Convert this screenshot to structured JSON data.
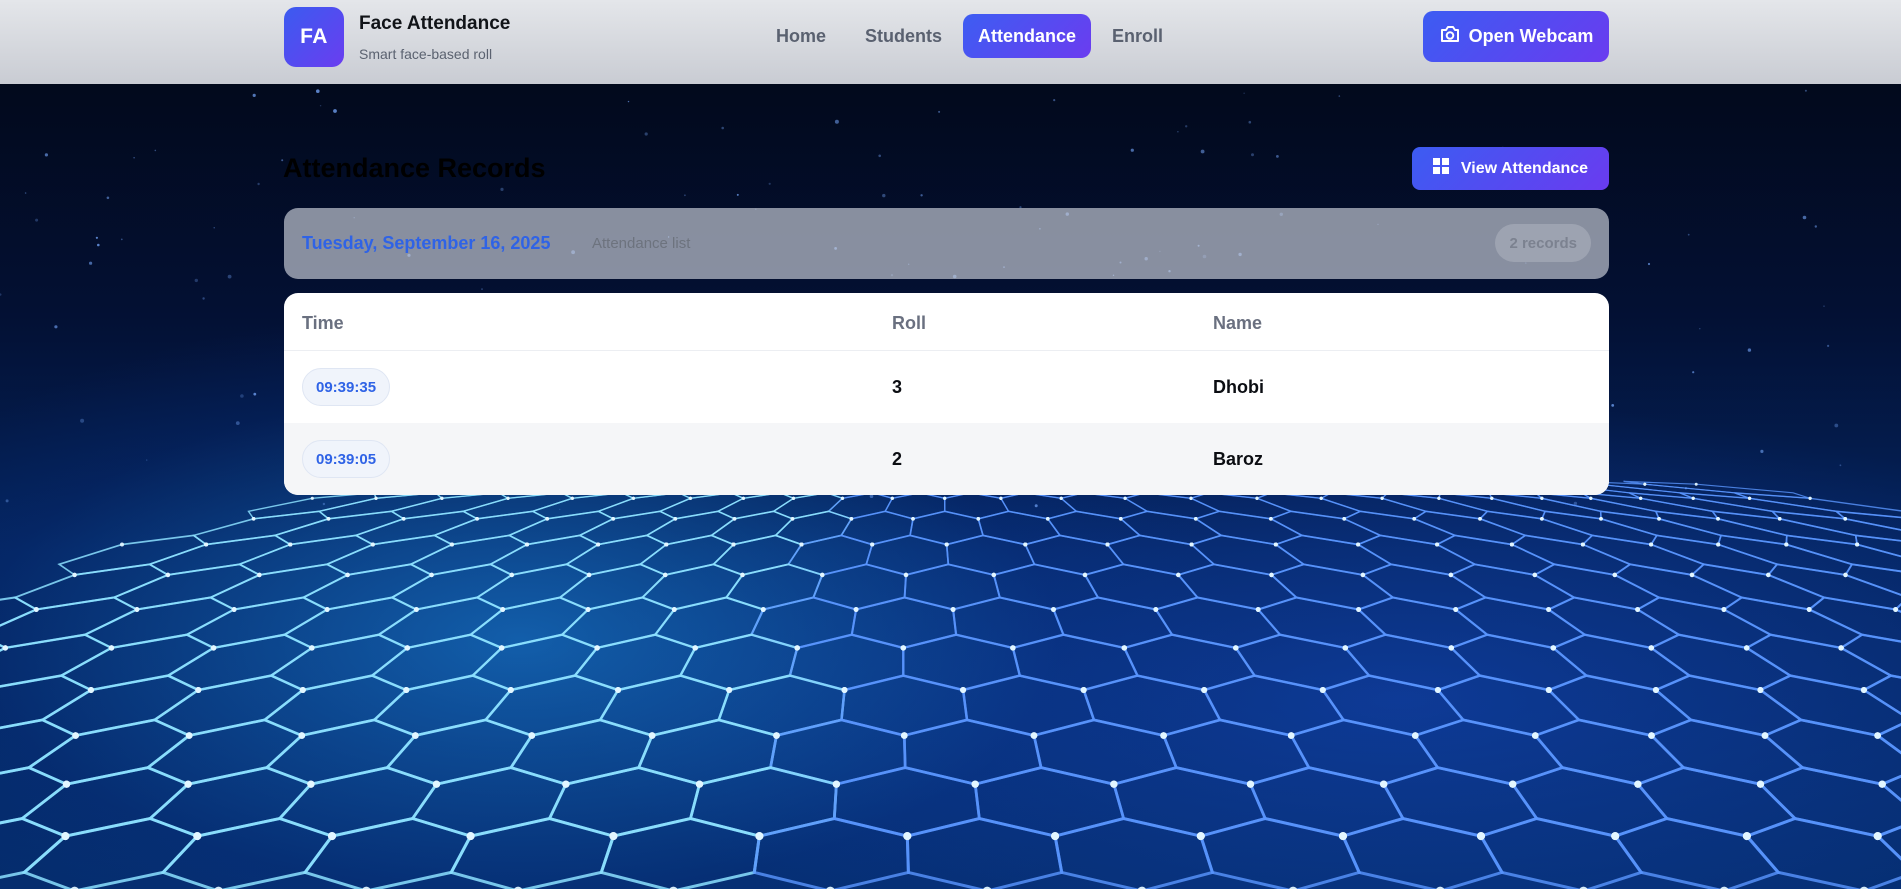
{
  "brand": {
    "logo_text": "FA",
    "title": "Face Attendance",
    "subtitle": "Smart face-based roll"
  },
  "nav": {
    "items": [
      {
        "label": "Home",
        "active": false
      },
      {
        "label": "Students",
        "active": false
      },
      {
        "label": "Attendance",
        "active": true
      },
      {
        "label": "Enroll",
        "active": false
      }
    ],
    "webcam_button": {
      "label": "Open Webcam",
      "icon": "camera-icon"
    }
  },
  "page": {
    "title": "Attendance Records",
    "view_button": {
      "label": "View Attendance",
      "icon": "grid-icon"
    }
  },
  "summary": {
    "date": "Tuesday, September 16, 2025",
    "subtitle": "Attendance list",
    "count": "2 records"
  },
  "table": {
    "headers": [
      "Time",
      "Roll",
      "Name"
    ],
    "rows": [
      {
        "time": "09:39:35",
        "roll": "3",
        "name": "Dhobi"
      },
      {
        "time": "09:39:05",
        "roll": "2",
        "name": "Baroz"
      }
    ]
  },
  "colors": {
    "accent_start": "#3c5cf2",
    "accent_end": "#6a3bf0",
    "date_text": "#2f63e6"
  }
}
